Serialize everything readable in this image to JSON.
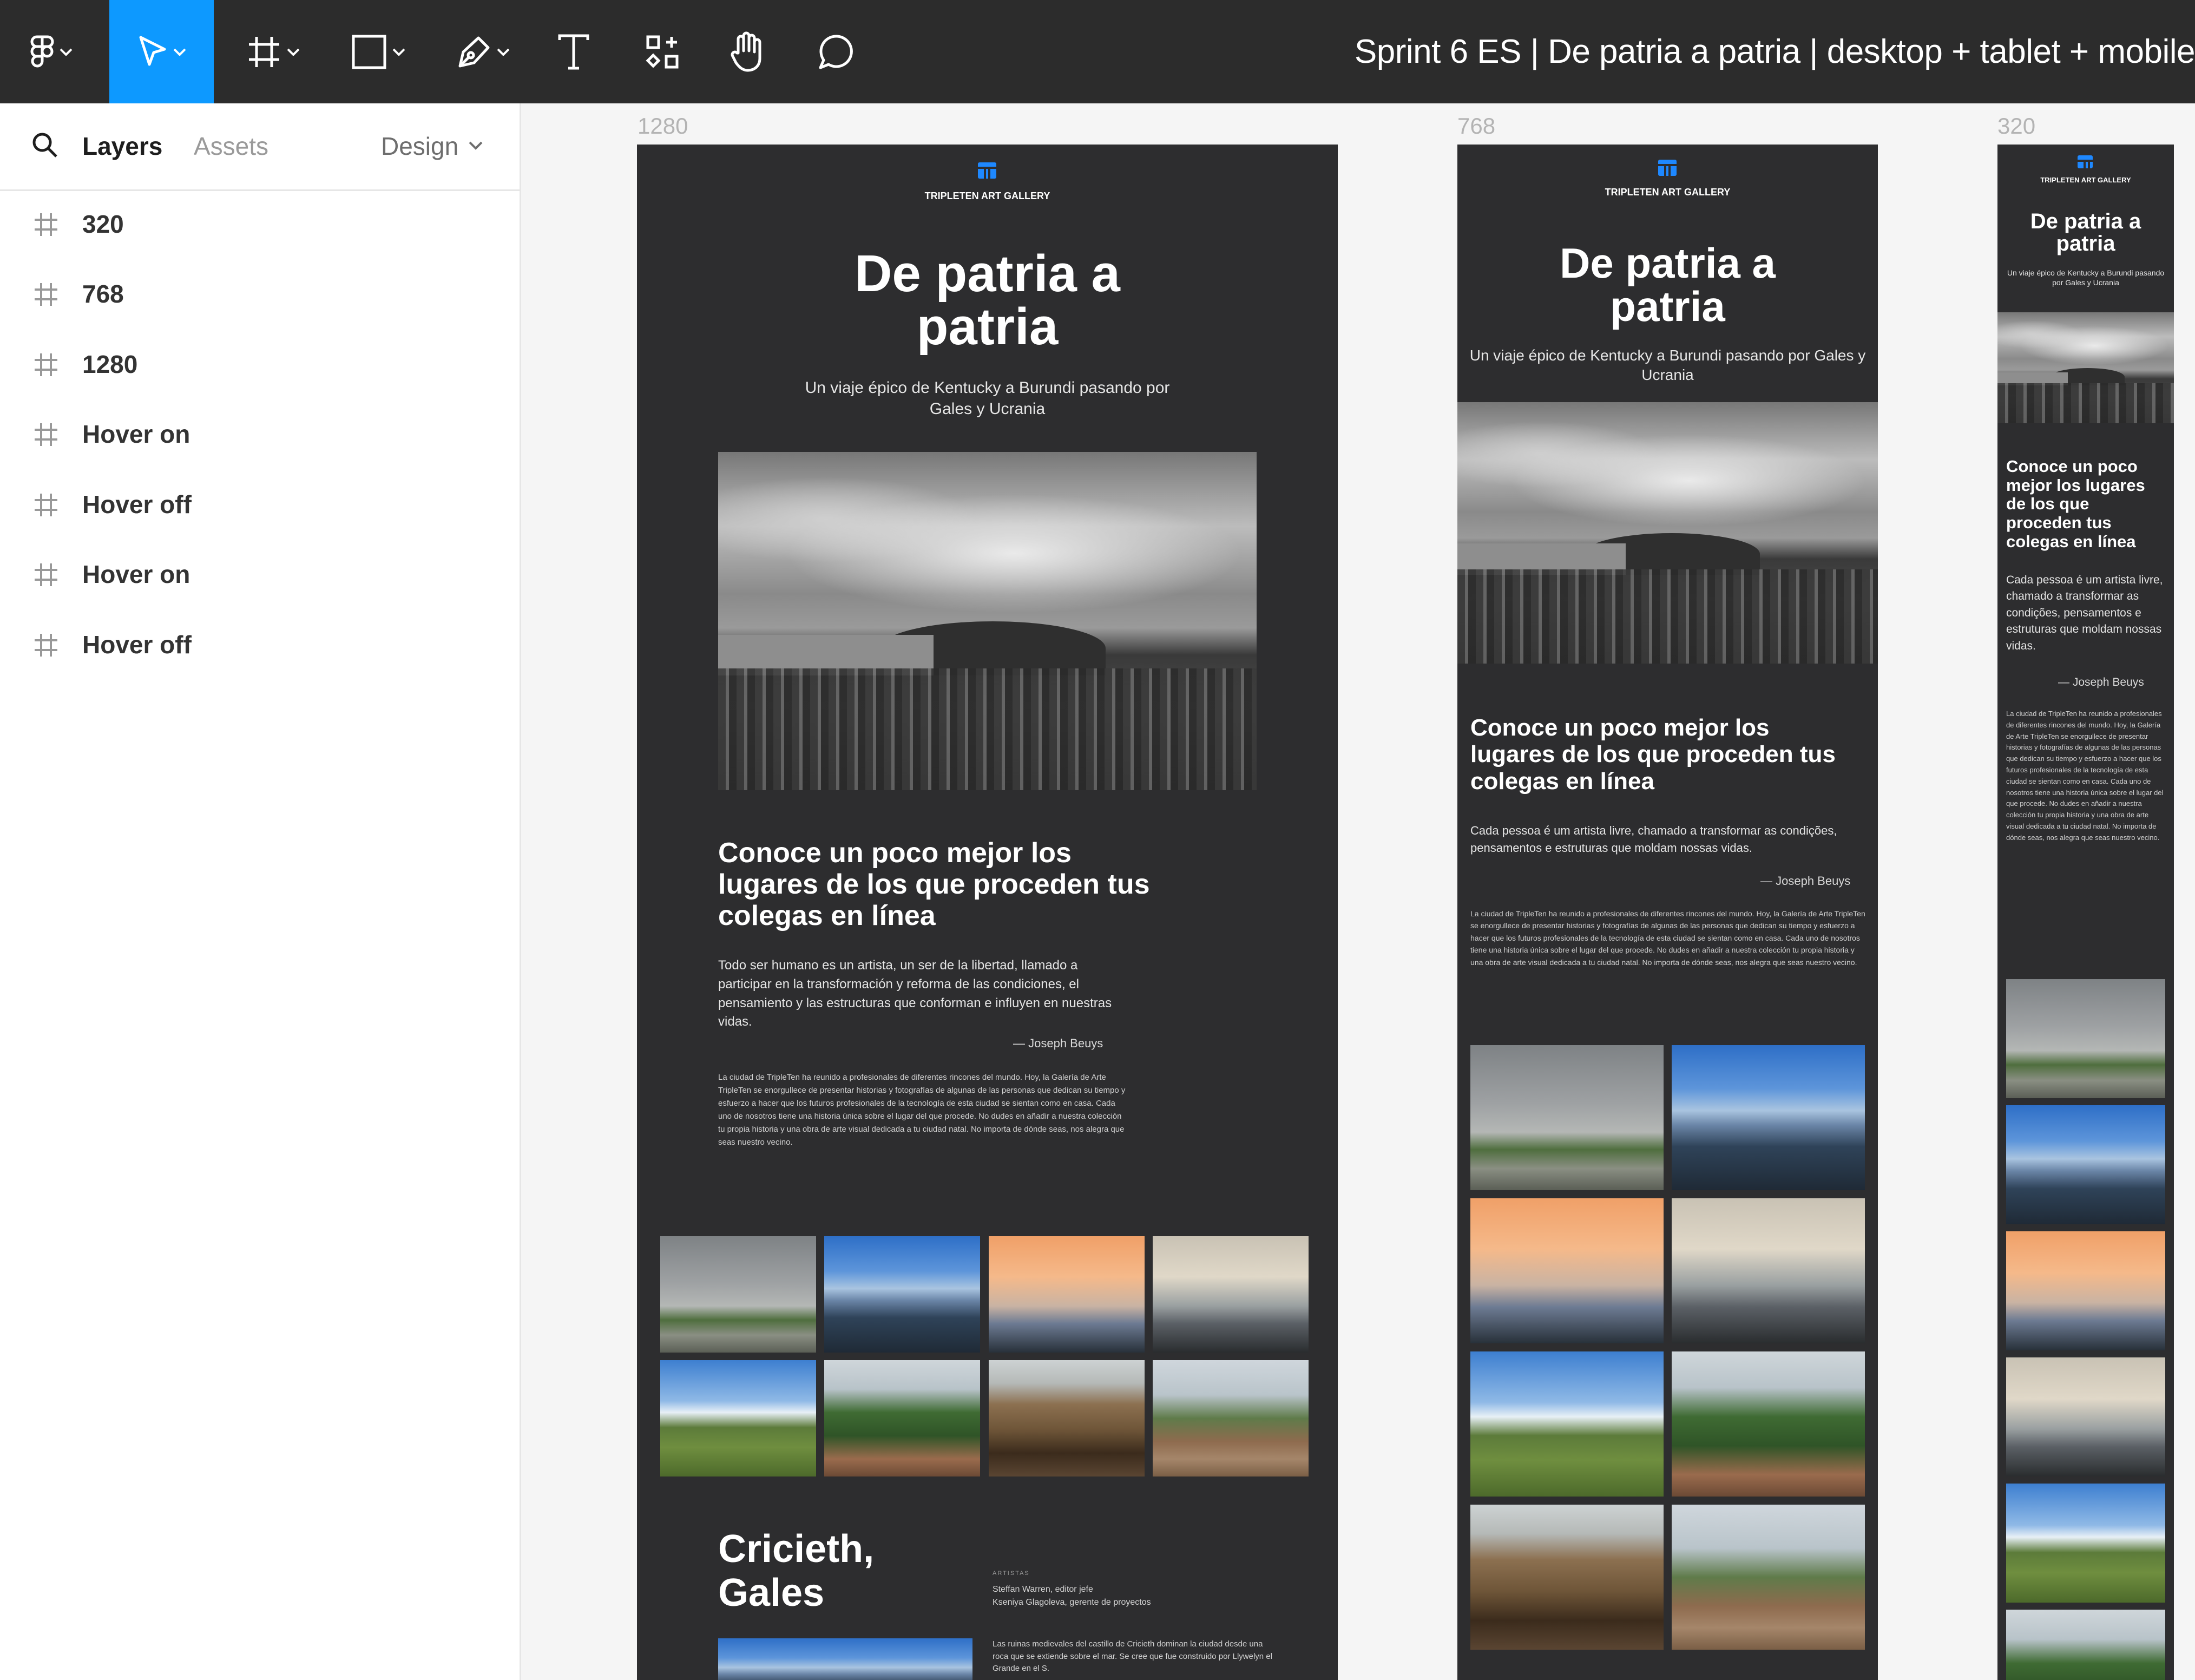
{
  "toolbar": {
    "tools": [
      {
        "name": "figma-menu-icon"
      },
      {
        "name": "move-tool-icon"
      },
      {
        "name": "frame-tool-icon"
      },
      {
        "name": "shape-tool-icon"
      },
      {
        "name": "pen-tool-icon"
      },
      {
        "name": "text-tool-icon"
      },
      {
        "name": "resources-icon"
      },
      {
        "name": "hand-tool-icon"
      },
      {
        "name": "comment-icon"
      }
    ],
    "document_title": "Sprint 6 ES | De patria a patria | desktop + tablet + mobile",
    "accent_color": "#0d99ff"
  },
  "left_panel": {
    "tabs": {
      "layers": "Layers",
      "assets": "Assets",
      "design": "Design"
    },
    "layers": [
      "320",
      "768",
      "1280",
      "Hover on",
      "Hover off",
      "Hover on",
      "Hover off"
    ]
  },
  "canvas": {
    "frames": [
      {
        "label": "1280"
      },
      {
        "label": "768"
      },
      {
        "label": "320"
      }
    ]
  },
  "site": {
    "logo": "TRIPLETEN ART GALLERY",
    "hero_title": "De patria a patria",
    "hero_subtitle": "Un viaje épico de Kentucky a Burundi pasando por Gales y Ucrania",
    "section_title": "Conoce un poco mejor los lugares de los que proceden tus colegas en línea",
    "quote_es": "Todo ser humano es un artista, un ser de la libertad, llamado a participar en la transformación y reforma de las condiciones, el pensamiento y las estructuras que conforman e influyen en nuestras vidas.",
    "quote_pt": "Cada pessoa é um artista livre, chamado a transformar as condições, pensamentos e estruturas que moldam nossas vidas.",
    "quote_author": "— Joseph Beuys",
    "body_text": "La ciudad de TripleTen ha reunido a profesionales de diferentes rincones del mundo. Hoy, la Galería de Arte TripleTen se enorgullece de presentar historias y fotografías de algunas de las personas que dedican su tiempo y esfuerzo a hacer que los futuros profesionales de la tecnología de esta ciudad se sientan como en casa. Cada uno de nosotros tiene una historia única sobre el lugar del que procede. No dudes en añadir a nuestra colección tu propia historia y una obra de arte visual dedicada a tu ciudad natal. No importa de dónde seas, nos alegra que seas nuestro vecino.",
    "city_title": "Cricieth, Gales",
    "artists_label": "ARTISTAS",
    "artists": "Steffan Warren, editor jefe\nKseniya Glagoleva, gerente de proyectos",
    "city_text": "Las ruinas medievales del castillo de Cricieth dominan la ciudad desde una roca que se extiende sobre el mar. Se cree que fue construido por Llywelyn el Grande en el S."
  }
}
